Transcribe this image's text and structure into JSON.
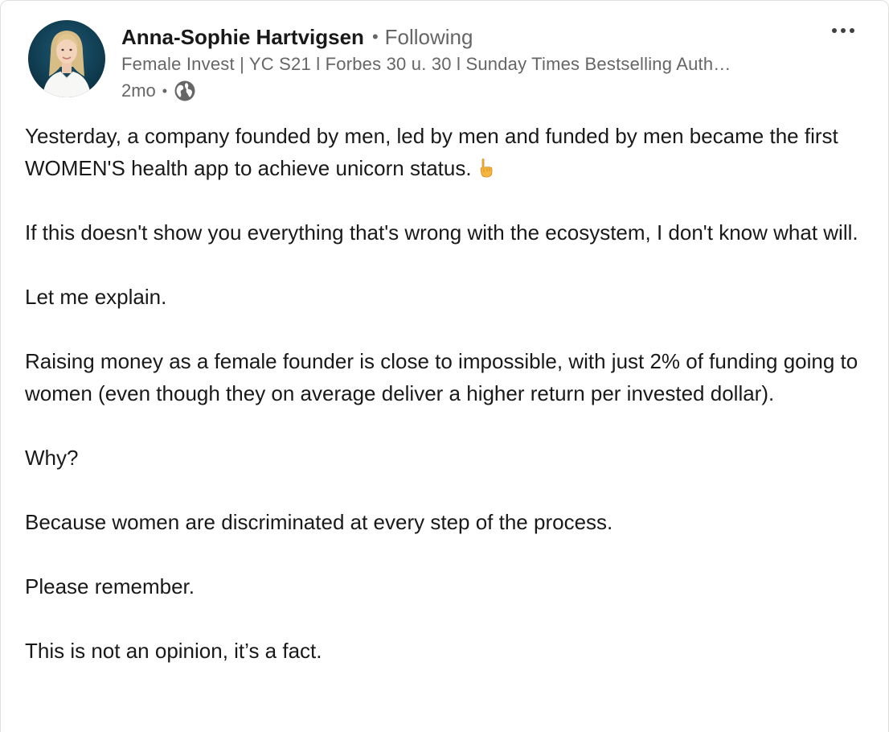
{
  "post": {
    "author": {
      "name": "Anna-Sophie Hartvigsen",
      "follow_separator": "•",
      "follow_status": "Following",
      "headline": "Female Invest | YC S21 l Forbes 30 u. 30 l Sunday Times Bestselling Auth…",
      "time": "2mo",
      "meta_separator": "•",
      "visibility_icon": "globe-icon"
    },
    "menu_icon": "more-horizontal-icon",
    "emoji_icon": "pointing-down-hand-icon",
    "paragraphs": [
      "Yesterday, a company founded by men, led by men and funded by men became the first WOMEN'S health app to achieve unicorn status.",
      "If this doesn't show you everything that's wrong with the ecosystem, I don't know what will.",
      "Let me explain.",
      "Raising money as a female founder is close to impossible, with just 2% of funding going to women (even though they on average deliver a higher return per invested dollar).",
      "Why?",
      "Because women are discriminated at every step of the process.",
      "Please remember.",
      "This is not an opinion, it’s a fact."
    ],
    "colors": {
      "text_primary": "#191919",
      "text_secondary": "#666666",
      "avatar_background": "#0d3a4f"
    }
  }
}
